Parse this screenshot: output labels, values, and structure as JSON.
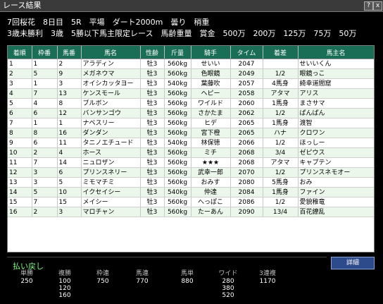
{
  "window": {
    "title": "レース結果",
    "help_label": "?",
    "close_label": "x"
  },
  "race": {
    "line1": "7回桜花　8日目　5R　平場　ダート2000m　曇り　稍重",
    "line2": "3歳未勝利　3歳　5勝以下馬主限定レース　馬齢重量　賞金　500万　200万　125万　75万　50万"
  },
  "table": {
    "headers": [
      "着順",
      "枠番",
      "馬番",
      "馬名",
      "性齢",
      "斤量",
      "騎手",
      "タイム",
      "着差",
      "馬主名"
    ],
    "rows": [
      [
        "1",
        "1",
        "2",
        "アラディン",
        "牡3",
        "560kg",
        "せいい",
        "2047",
        "",
        "せいいくん"
      ],
      [
        "2",
        "5",
        "9",
        "メガネウマ",
        "牡3",
        "560kg",
        "色眼鏡",
        "2049",
        "1/2",
        "眼鏡っこ"
      ],
      [
        "3",
        "1",
        "3",
        "オイシカッタヨー",
        "牡3",
        "540kg",
        "葉藤吹",
        "2057",
        "4馬身",
        "綺幸道閻窟"
      ],
      [
        "4",
        "7",
        "13",
        "ケンスモール",
        "牡3",
        "560kg",
        "ヘピー",
        "2058",
        "アタマ",
        "アリス"
      ],
      [
        "5",
        "4",
        "8",
        "ブルボン",
        "牡3",
        "560kg",
        "ワイルド",
        "2060",
        "1馬身",
        "まさサマ"
      ],
      [
        "6",
        "6",
        "12",
        "バンサンゴウ",
        "牡3",
        "560kg",
        "さかたま",
        "2062",
        "1/2",
        "ぱんぱん"
      ],
      [
        "7",
        "1",
        "1",
        "ナベスリー",
        "牡3",
        "560kg",
        "ヒデ",
        "2065",
        "1馬身",
        "渡智"
      ],
      [
        "8",
        "8",
        "16",
        "ダンダン",
        "牡3",
        "560kg",
        "宮下橙",
        "2065",
        "ハナ",
        "クロワン"
      ],
      [
        "9",
        "6",
        "11",
        "タニノエチュード",
        "牡3",
        "540kg",
        "林保徳",
        "2066",
        "1/2",
        "ほっしー"
      ],
      [
        "10",
        "2",
        "4",
        "ホース",
        "牡3",
        "560kg",
        "ミチ",
        "2068",
        "3/4",
        "ゼピウス"
      ],
      [
        "11",
        "7",
        "14",
        "ニュロザン",
        "牡3",
        "560kg",
        "★★★",
        "2068",
        "アタマ",
        "キャプテン"
      ],
      [
        "12",
        "3",
        "6",
        "プリンスネリー",
        "牡3",
        "560kg",
        "武幸一郎",
        "2070",
        "1/2",
        "プリンスネモオー"
      ],
      [
        "13",
        "3",
        "5",
        "ミモマチミ",
        "牡3",
        "560kg",
        "おみす",
        "2080",
        "5馬身",
        "おみ"
      ],
      [
        "14",
        "5",
        "10",
        "イクセイシー",
        "牡3",
        "540kg",
        "仲達",
        "2084",
        "1馬身",
        "ファイン"
      ],
      [
        "15",
        "7",
        "15",
        "メイシー",
        "牡3",
        "560kg",
        "へっぽこ",
        "2086",
        "1/2",
        "愛貌稚竜"
      ],
      [
        "16",
        "2",
        "3",
        "マロチャン",
        "牡3",
        "560kg",
        "たーあん",
        "2090",
        "13/4",
        "百花繚乱"
      ]
    ]
  },
  "payout": {
    "title": "払い戻し",
    "columns": [
      {
        "label": "単勝",
        "values": [
          "250"
        ]
      },
      {
        "label": "複勝",
        "values": [
          "100",
          "120",
          "160"
        ]
      },
      {
        "label": "枠連",
        "values": [
          "750"
        ]
      },
      {
        "label": "馬連",
        "values": [
          "770"
        ]
      },
      {
        "label": "馬単",
        "values": [
          "880"
        ]
      },
      {
        "label": "ワイド",
        "values": [
          "280",
          "380",
          "520"
        ]
      },
      {
        "label": "3連複",
        "values": [
          "1170"
        ]
      }
    ]
  },
  "detail_button": {
    "label": "詳細"
  },
  "colors": {
    "header_green": "#1a6e56",
    "row_alt": "#eaf7ea",
    "payout_title": "#7fff7f",
    "button_blue": "#2d4b8a"
  }
}
